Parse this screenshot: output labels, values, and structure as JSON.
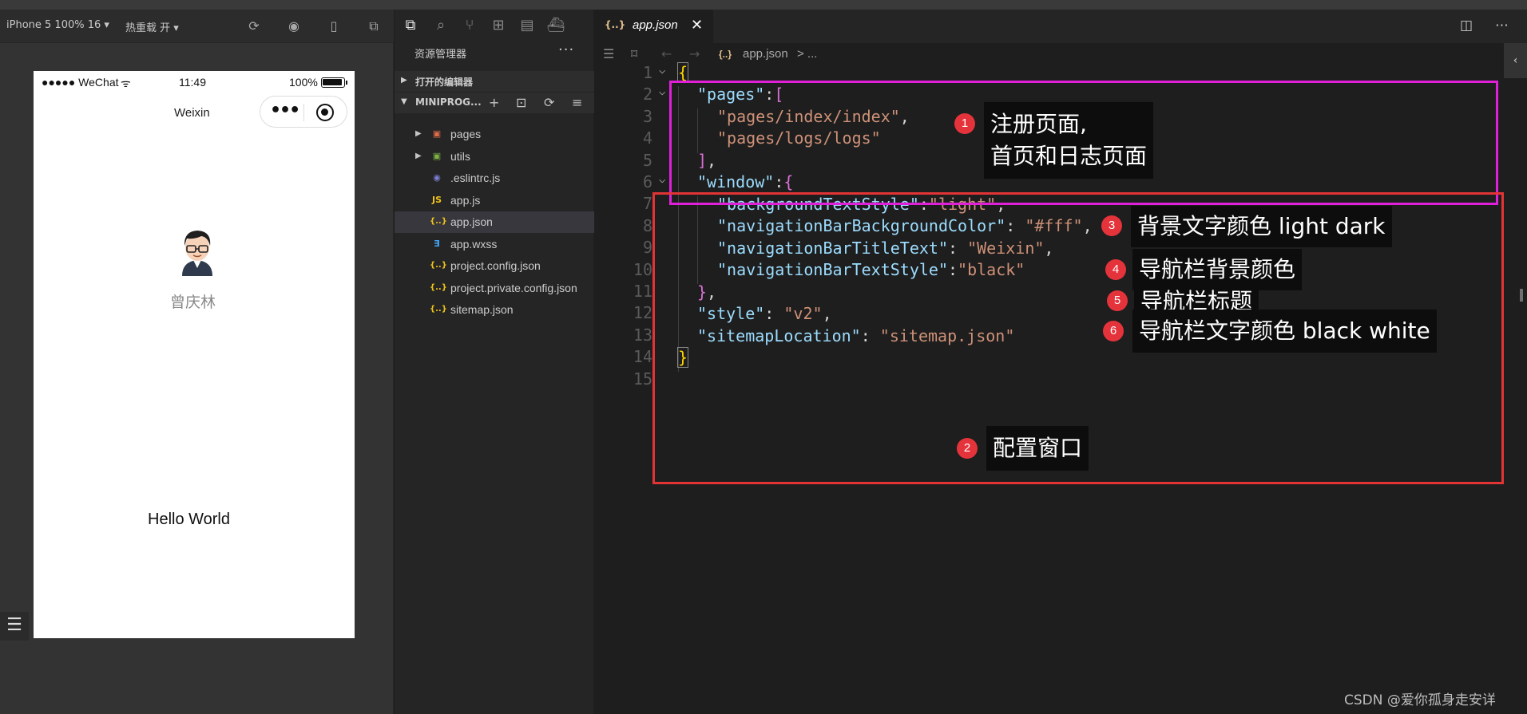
{
  "simulator": {
    "device_label": "iPhone 5 100% 16 ▾",
    "hot_reload": "热重载 开 ▾",
    "status": {
      "carrier": "●●●●● WeChat",
      "time": "11:49",
      "battery": "100%"
    },
    "nav_title": "Weixin",
    "capsule_dots": "•••",
    "user_name": "曾庆林",
    "hello": "Hello World",
    "list_icon": "☰"
  },
  "explorer": {
    "title": "资源管理器",
    "more": "···",
    "open_editors": "打开的编辑器",
    "project": "MINIPROG...",
    "files": [
      {
        "name": "pages",
        "icon": "folder-red-icon",
        "glyph": "▣",
        "color": "#e06c4a"
      },
      {
        "name": "utils",
        "icon": "folder-green-icon",
        "glyph": "▣",
        "color": "#7cb342"
      },
      {
        "name": ".eslintrc.js",
        "icon": "eslint-icon",
        "glyph": "◉",
        "color": "#7b7fd1"
      },
      {
        "name": "app.js",
        "icon": "js-icon",
        "glyph": "JS",
        "color": "#f0c419"
      },
      {
        "name": "app.json",
        "icon": "json-icon",
        "glyph": "{..}",
        "color": "#f0c419"
      },
      {
        "name": "app.wxss",
        "icon": "css-icon",
        "glyph": "∃",
        "color": "#42a5f5"
      },
      {
        "name": "project.config.json",
        "icon": "json-icon",
        "glyph": "{..}",
        "color": "#f0c419"
      },
      {
        "name": "project.private.config.json",
        "icon": "json-icon",
        "glyph": "{..}",
        "color": "#f0c419"
      },
      {
        "name": "sitemap.json",
        "icon": "json-icon",
        "glyph": "{..}",
        "color": "#f0c419"
      }
    ]
  },
  "editor": {
    "tab_icon": "{..}",
    "tab_name": "app.json",
    "tab_close": "✕",
    "breadcrumb_file": "app.json",
    "breadcrumb_rest": "> ...",
    "line_numbers": [
      "1",
      "2",
      "3",
      "4",
      "5",
      "6",
      "7",
      "8",
      "9",
      "10",
      "11",
      "12",
      "13",
      "14",
      "15"
    ]
  },
  "annotations": {
    "n1": "1",
    "t1": "注册页面,\n首页和日志页面",
    "n2": "2",
    "t2": "配置窗口",
    "n3": "3",
    "t3": "背景文字颜色 light dark",
    "n4": "4",
    "t4": "导航栏背景颜色",
    "n5": "5",
    "t5": "导航栏标题",
    "n6": "6",
    "t6": "导航栏文字颜色 black white"
  },
  "watermark": "CSDN @爱你孤身走安详",
  "colors": {
    "magenta_box": "#e020d8",
    "red_box": "#e23434",
    "badge": "#e5333b"
  }
}
